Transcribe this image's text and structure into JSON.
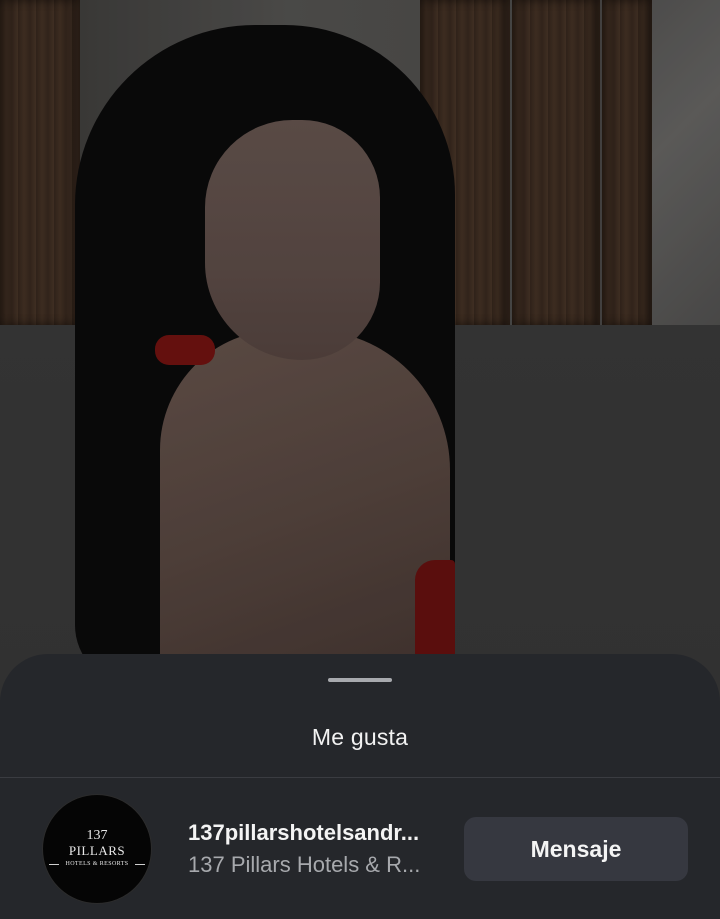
{
  "sheet": {
    "title": "Me gusta"
  },
  "liker": {
    "avatar_logo": {
      "line1": "137",
      "line2": "PILLARS",
      "line3": "HOTELS & RESORTS"
    },
    "username": "137pillarshotelsandr...",
    "full_name": "137 Pillars Hotels & R...",
    "message_button_label": "Mensaje"
  }
}
